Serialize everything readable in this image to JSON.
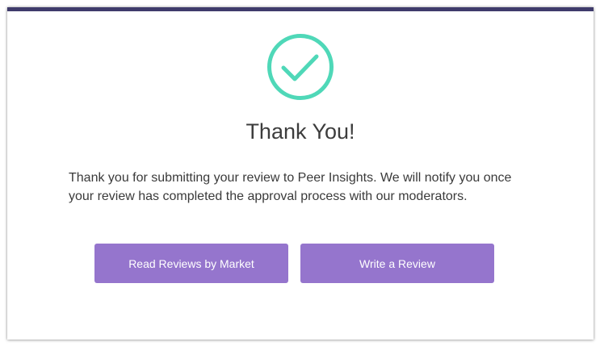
{
  "colors": {
    "top_bar": "#3f3b6b",
    "check_accent": "#4fd8b8",
    "button_bg": "#9575cd",
    "button_text": "#ffffff",
    "title_text": "#3d3d3d"
  },
  "icon": {
    "name": "check-circle-icon"
  },
  "dialog": {
    "title": "Thank You!",
    "message_line1": "Thank you for submitting your review to Peer Insights. We will notify you once",
    "message_line2": "your review has completed the approval process with our moderators."
  },
  "actions": {
    "read_reviews_label": "Read Reviews by Market",
    "write_review_label": "Write a Review"
  }
}
